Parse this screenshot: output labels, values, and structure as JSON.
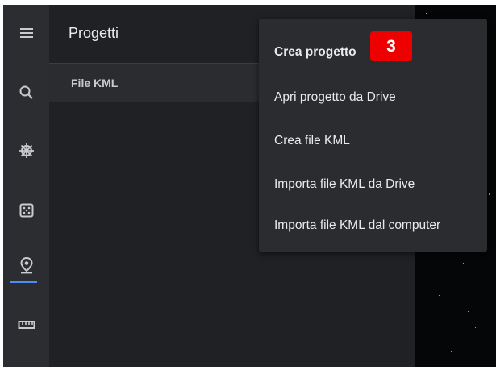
{
  "panel": {
    "title": "Progetti",
    "section_label": "File KML"
  },
  "rail": {
    "icons": [
      "menu-icon",
      "search-icon",
      "voyager-icon",
      "feeling-lucky-icon",
      "projects-icon",
      "measure-icon"
    ],
    "active": "projects-icon",
    "accent_color": "#4b8cf5"
  },
  "menu": {
    "items": [
      {
        "label": "Crea progetto",
        "bold": true
      },
      {
        "label": "Apri progetto da Drive"
      },
      {
        "label": "Crea file KML"
      },
      {
        "label": "Importa file KML da Drive"
      },
      {
        "label": "Importa file KML dal computer"
      }
    ]
  },
  "step_badge": {
    "label": "3",
    "color": "#ee0000"
  }
}
